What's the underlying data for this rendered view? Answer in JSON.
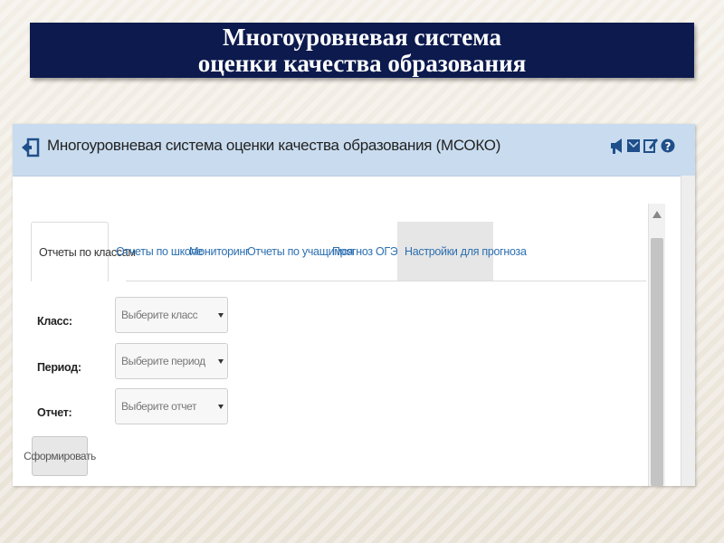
{
  "slide": {
    "title_line1": "Многоуровневая система",
    "title_line2": "оценки качества образования",
    "banner_color": "#0c1a4e"
  },
  "app": {
    "title": "Многоуровневая система оценки качества образования (МСОКО)",
    "header_color": "#c9dcef",
    "header_icons": [
      "exit-icon",
      "megaphone-icon",
      "mail-icon",
      "help-icon"
    ]
  },
  "tabs": [
    {
      "label": "Отчеты по классам",
      "active": true
    },
    {
      "label": "Отчеты по школе",
      "active": false
    },
    {
      "label": "Мониторинг",
      "active": false
    },
    {
      "label": "Отчеты по учащимся",
      "active": false
    },
    {
      "label": "Прогноз ОГЭ/ЕГЭ",
      "active": false
    },
    {
      "label": "Настройки для прогноза",
      "active": false
    }
  ],
  "form": {
    "class_label": "Класс:",
    "class_value": "Выберите класс",
    "period_label": "Период:",
    "period_value": "Выберите период",
    "report_label": "Отчет:",
    "report_value": "Выберите отчет",
    "submit_label": "Сформировать"
  }
}
